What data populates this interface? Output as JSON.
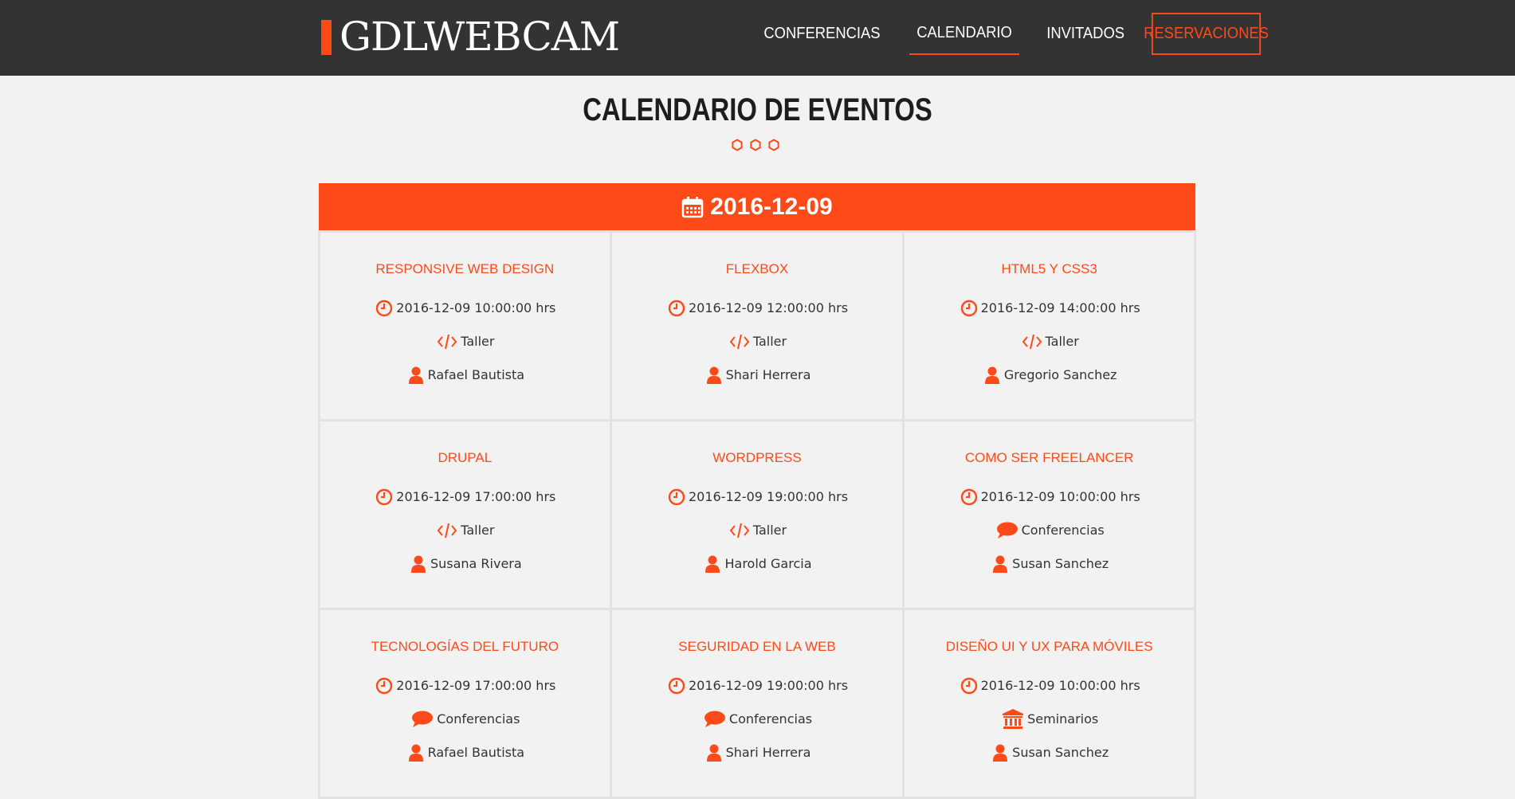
{
  "header": {
    "logo": "GDLWEBCAM",
    "nav": [
      {
        "label": "Conferencias",
        "active": false
      },
      {
        "label": "Calendario",
        "active": true
      },
      {
        "label": "Invitados",
        "active": false
      },
      {
        "label": "Reservaciones",
        "cta": true
      }
    ]
  },
  "page_title": "Calendario de Eventos",
  "accent_color": "#fe4918",
  "date": "2016-12-09",
  "events": [
    {
      "title": "Responsive Web Design",
      "datetime": "2016-12-09 10:00:00 hrs",
      "category": "Taller",
      "category_icon": "code-icon",
      "speaker": "Rafael Bautista"
    },
    {
      "title": "Flexbox",
      "datetime": "2016-12-09 12:00:00 hrs",
      "category": "Taller",
      "category_icon": "code-icon",
      "speaker": "Shari Herrera"
    },
    {
      "title": "HTML5 y CSS3",
      "datetime": "2016-12-09 14:00:00 hrs",
      "category": "Taller",
      "category_icon": "code-icon",
      "speaker": "Gregorio Sanchez"
    },
    {
      "title": "Drupal",
      "datetime": "2016-12-09 17:00:00 hrs",
      "category": "Taller",
      "category_icon": "code-icon",
      "speaker": "Susana Rivera"
    },
    {
      "title": "WordPress",
      "datetime": "2016-12-09 19:00:00 hrs",
      "category": "Taller",
      "category_icon": "code-icon",
      "speaker": "Harold Garcia"
    },
    {
      "title": "Como ser freelancer",
      "datetime": "2016-12-09 10:00:00 hrs",
      "category": "Conferencias",
      "category_icon": "comment-icon",
      "speaker": "Susan Sanchez"
    },
    {
      "title": "Tecnologías del Futuro",
      "datetime": "2016-12-09 17:00:00 hrs",
      "category": "Conferencias",
      "category_icon": "comment-icon",
      "speaker": "Rafael Bautista"
    },
    {
      "title": "Seguridad en la Web",
      "datetime": "2016-12-09 19:00:00 hrs",
      "category": "Conferencias",
      "category_icon": "comment-icon",
      "speaker": "Shari Herrera"
    },
    {
      "title": "Diseño UI y UX para móviles",
      "datetime": "2016-12-09 10:00:00 hrs",
      "category": "Seminarios",
      "category_icon": "university-icon",
      "speaker": "Susan Sanchez"
    }
  ]
}
